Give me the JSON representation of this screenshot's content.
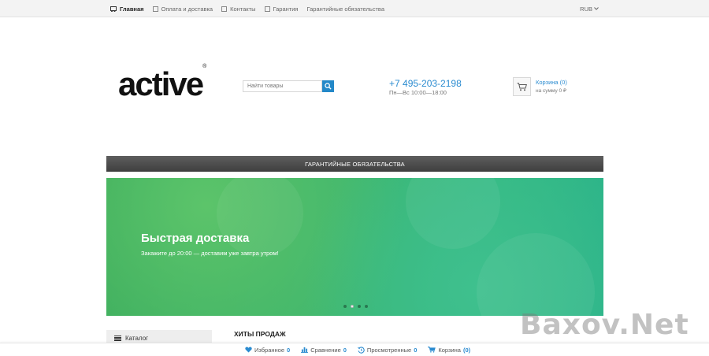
{
  "topnav": {
    "items": [
      {
        "label": "Главная",
        "icon": "cart-icon"
      },
      {
        "label": "Оплата и доставка",
        "icon": "page-icon"
      },
      {
        "label": "Контакты",
        "icon": "page-icon"
      },
      {
        "label": "Гарантия",
        "icon": "page-icon"
      },
      {
        "label": "Гарантийные обязательства",
        "icon": ""
      }
    ],
    "currency": "RUB"
  },
  "header": {
    "logo": "active",
    "logo_mark": "®",
    "search_placeholder": "Найти товары",
    "phone": "+7 495-203-2198",
    "hours": "Пн—Вс 10:00—18:00",
    "cart_title": "Корзина (0)",
    "cart_sum": "на сумму 0 ₽"
  },
  "menu": {
    "label": "ГАРАНТИЙНЫЕ ОБЯЗАТЕЛЬСТВА"
  },
  "banner": {
    "title": "Быстрая доставка",
    "subtitle": "Закажите до 20:00 — доставим уже завтра утром!",
    "slides": 4,
    "active_slide": 2
  },
  "sidebar": {
    "catalog_label": "Каталог"
  },
  "main": {
    "hits_title": "ХИТЫ ПРОДАЖ"
  },
  "bottombar": {
    "favorites_label": "Избранное",
    "favorites_count": "0",
    "compare_label": "Сравнение",
    "compare_count": "0",
    "viewed_label": "Просмотренные",
    "viewed_count": "0",
    "cart_label": "Корзина",
    "cart_count": "(0)"
  },
  "watermark": "Baxov.Net",
  "colors": {
    "accent": "#2a8bd0",
    "menubar": "#4a4a4a",
    "banner": "#3db56f"
  }
}
